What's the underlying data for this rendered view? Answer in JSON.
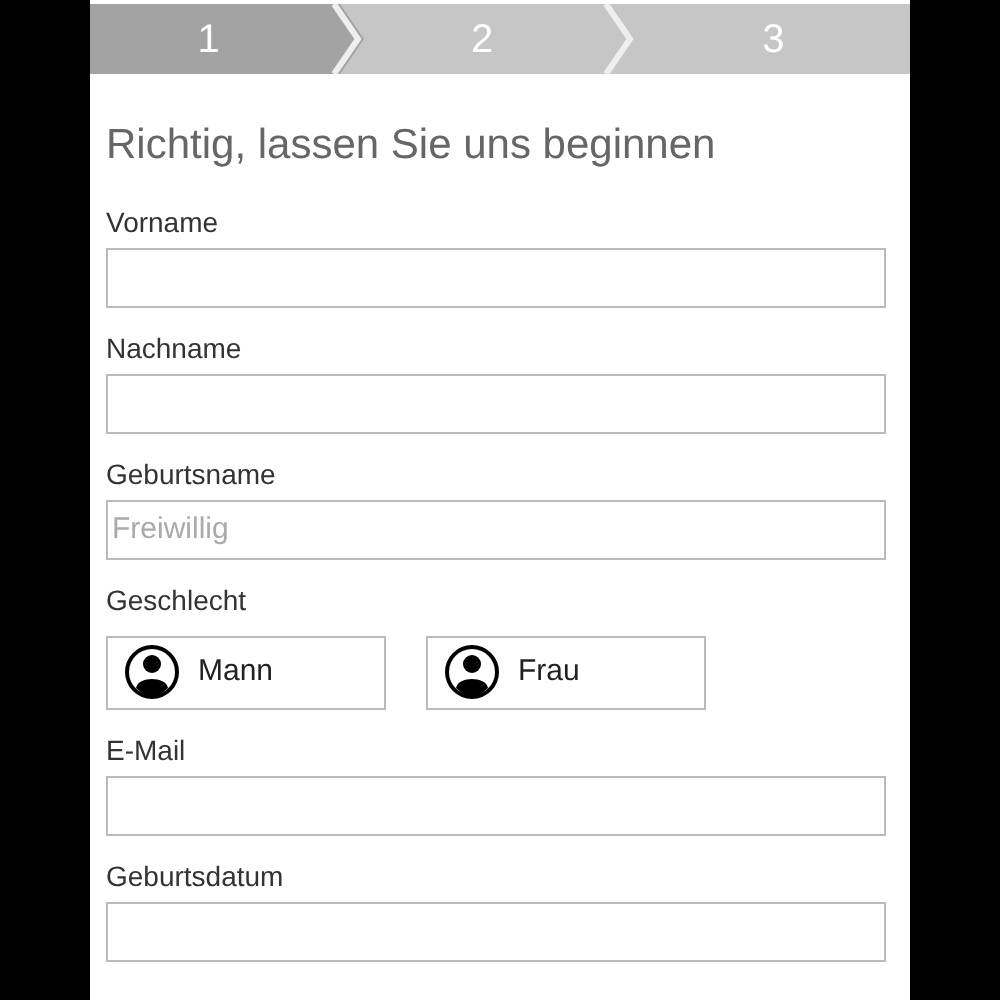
{
  "steps": [
    {
      "label": "1",
      "selected": true
    },
    {
      "label": "2",
      "selected": false
    },
    {
      "label": "3",
      "selected": false
    }
  ],
  "title": "Richtig, lassen Sie uns beginnen",
  "fields": [
    {
      "kind": "text",
      "label": "Vorname"
    },
    {
      "kind": "text",
      "label": "Nachname"
    },
    {
      "kind": "text",
      "label": "Geburtsname",
      "placeholder": "Freiwillig"
    },
    {
      "kind": "gender",
      "label": "Geschlecht",
      "options": [
        {
          "label": "Mann",
          "selected": false
        },
        {
          "label": "Frau",
          "selected": false
        }
      ]
    },
    {
      "kind": "text",
      "label": "E-Mail"
    },
    {
      "kind": "text",
      "label": "Geburtsdatum"
    }
  ]
}
